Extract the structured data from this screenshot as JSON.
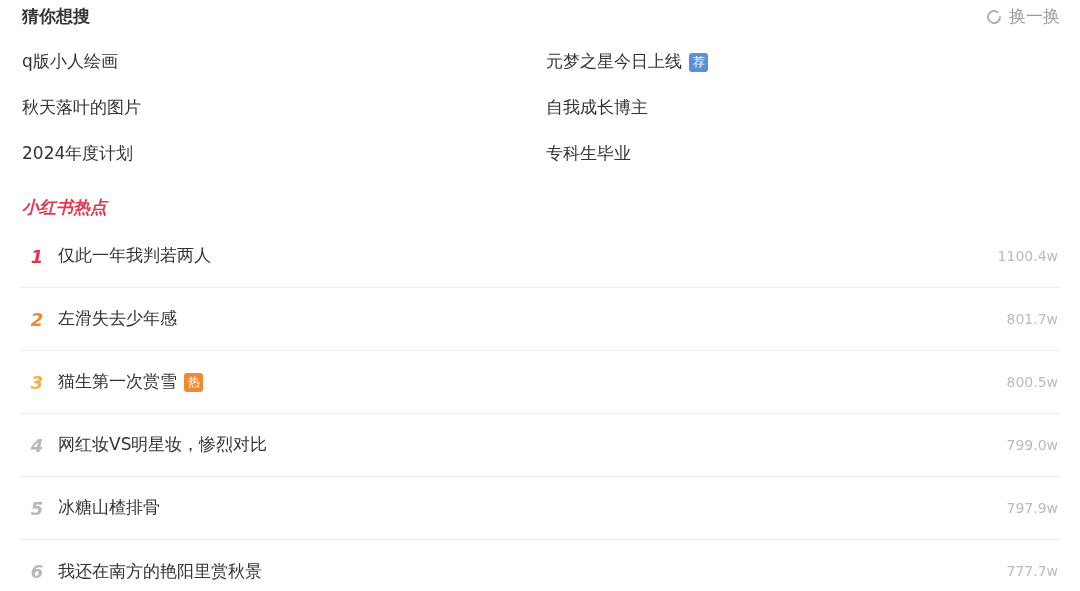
{
  "header": {
    "title": "猜你想搜",
    "refresh_label": "换一换"
  },
  "suggestions": [
    {
      "text": "q版小人绘画"
    },
    {
      "text": "元梦之星今日上线",
      "badge": {
        "kind": "recommend",
        "text": "荐"
      }
    },
    {
      "text": "秋天落叶的图片"
    },
    {
      "text": "自我成长博主"
    },
    {
      "text": "2024年度计划"
    },
    {
      "text": "专科生毕业"
    }
  ],
  "hot_section": {
    "title": "小红书热点",
    "items": [
      {
        "rank": "1",
        "color": "#e5334f",
        "title": "仅此一年我判若两人",
        "heat": "1100.4w"
      },
      {
        "rank": "2",
        "color": "#f0892e",
        "title": "左滑失去少年感",
        "heat": "801.7w"
      },
      {
        "rank": "3",
        "color": "#f2b340",
        "title": "猫生第一次赏雪",
        "badge": {
          "kind": "hot",
          "text": "热"
        },
        "heat": "800.5w"
      },
      {
        "rank": "4",
        "color": "#b8b8b8",
        "title": "网红妆VS明星妆，惨烈对比",
        "heat": "799.0w"
      },
      {
        "rank": "5",
        "color": "#b8b8b8",
        "title": "冰糖山楂排骨",
        "heat": "797.9w"
      },
      {
        "rank": "6",
        "color": "#b8b8b8",
        "title": "我还在南方的艳阳里赏秋景",
        "heat": "777.7w"
      }
    ]
  }
}
